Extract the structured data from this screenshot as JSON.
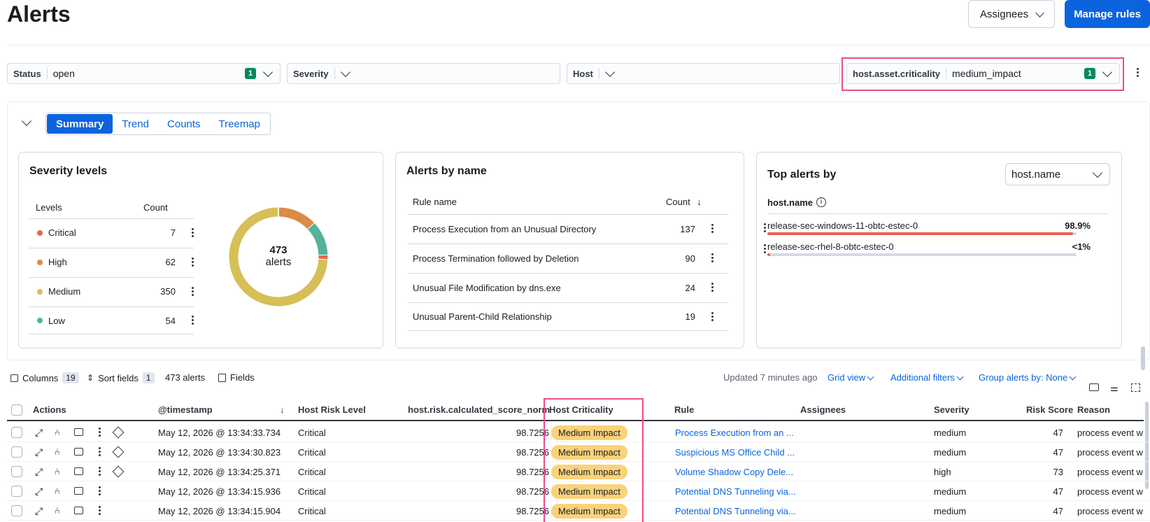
{
  "page": {
    "title": "Alerts"
  },
  "header": {
    "assignees_label": "Assignees",
    "manage_rules_label": "Manage rules"
  },
  "filters": [
    {
      "label": "Status",
      "value": "open",
      "count": "1"
    },
    {
      "label": "Severity",
      "value": "",
      "count": ""
    },
    {
      "label": "Host",
      "value": "",
      "count": ""
    },
    {
      "label": "host.asset.criticality",
      "value": "medium_impact",
      "count": "1"
    }
  ],
  "tabs": [
    "Summary",
    "Trend",
    "Counts",
    "Treemap"
  ],
  "severity_card": {
    "title": "Severity levels",
    "col_levels": "Levels",
    "col_count": "Count",
    "rows": [
      {
        "label": "Critical",
        "count": "7",
        "color": "#e7664c"
      },
      {
        "label": "High",
        "count": "62",
        "color": "#da8b45"
      },
      {
        "label": "Medium",
        "count": "350",
        "color": "#d6bf57"
      },
      {
        "label": "Low",
        "count": "54",
        "color": "#54b399"
      }
    ],
    "donut_total": "473",
    "donut_label": "alerts"
  },
  "alerts_by_name": {
    "title": "Alerts by name",
    "col_rule": "Rule name",
    "col_count": "Count",
    "rows": [
      {
        "name": "Process Execution from an Unusual Directory",
        "count": "137"
      },
      {
        "name": "Process Termination followed by Deletion",
        "count": "90"
      },
      {
        "name": "Unusual File Modification by dns.exe",
        "count": "24"
      },
      {
        "name": "Unusual Parent-Child Relationship",
        "count": "19"
      }
    ]
  },
  "top_alerts": {
    "title": "Top alerts by",
    "select_value": "host.name",
    "field_label": "host.name",
    "rows": [
      {
        "name": "release-sec-windows-11-obtc-estec-0",
        "pct": "98.9%",
        "fill": 0.989
      },
      {
        "name": "release-sec-rhel-8-obtc-estec-0",
        "pct": "<1%",
        "fill": 0.005
      }
    ]
  },
  "toolbar": {
    "columns_label": "Columns",
    "columns_count": "19",
    "sort_label": "Sort fields",
    "sort_count": "1",
    "alerts_count": "473 alerts",
    "fields_label": "Fields",
    "updated": "Updated 7 minutes ago",
    "grid_view": "Grid view",
    "additional_filters": "Additional filters",
    "group_by": "Group alerts by: None"
  },
  "table": {
    "headers": {
      "actions": "Actions",
      "timestamp": "@timestamp",
      "host_risk": "Host Risk Level",
      "score": "host.risk.calculated_score_norm",
      "criticality": "Host Criticality",
      "rule": "Rule",
      "assignees": "Assignees",
      "severity": "Severity",
      "risk_score": "Risk Score",
      "reason": "Reason"
    },
    "rows": [
      {
        "timestamp": "May 12, 2026 @ 13:34:33.734",
        "risk": "Critical",
        "score": "98.7256",
        "crit": "Medium Impact",
        "rule": "Process Execution from an ...",
        "severity": "medium",
        "risk_score": "47",
        "reason": "process event w"
      },
      {
        "timestamp": "May 12, 2026 @ 13:34:30.823",
        "risk": "Critical",
        "score": "98.7256",
        "crit": "Medium Impact",
        "rule": "Suspicious MS Office Child ...",
        "severity": "medium",
        "risk_score": "47",
        "reason": "process event w"
      },
      {
        "timestamp": "May 12, 2026 @ 13:34:25.371",
        "risk": "Critical",
        "score": "98.7256",
        "crit": "Medium Impact",
        "rule": "Volume Shadow Copy Dele...",
        "severity": "high",
        "risk_score": "73",
        "reason": "process event w"
      },
      {
        "timestamp": "May 12, 2026 @ 13:34:15.936",
        "risk": "Critical",
        "score": "98.7256",
        "crit": "Medium Impact",
        "rule": "Potential DNS Tunneling via...",
        "severity": "medium",
        "risk_score": "47",
        "reason": "process event w"
      },
      {
        "timestamp": "May 12, 2026 @ 13:34:15.904",
        "risk": "Critical",
        "score": "98.7256",
        "crit": "Medium Impact",
        "rule": "Potential DNS Tunneling via...",
        "severity": "medium",
        "risk_score": "47",
        "reason": "process event w"
      }
    ]
  },
  "colors": {
    "accent": "#0b64dd",
    "highlight": "#e94c8c",
    "pill": "#fad27a"
  }
}
